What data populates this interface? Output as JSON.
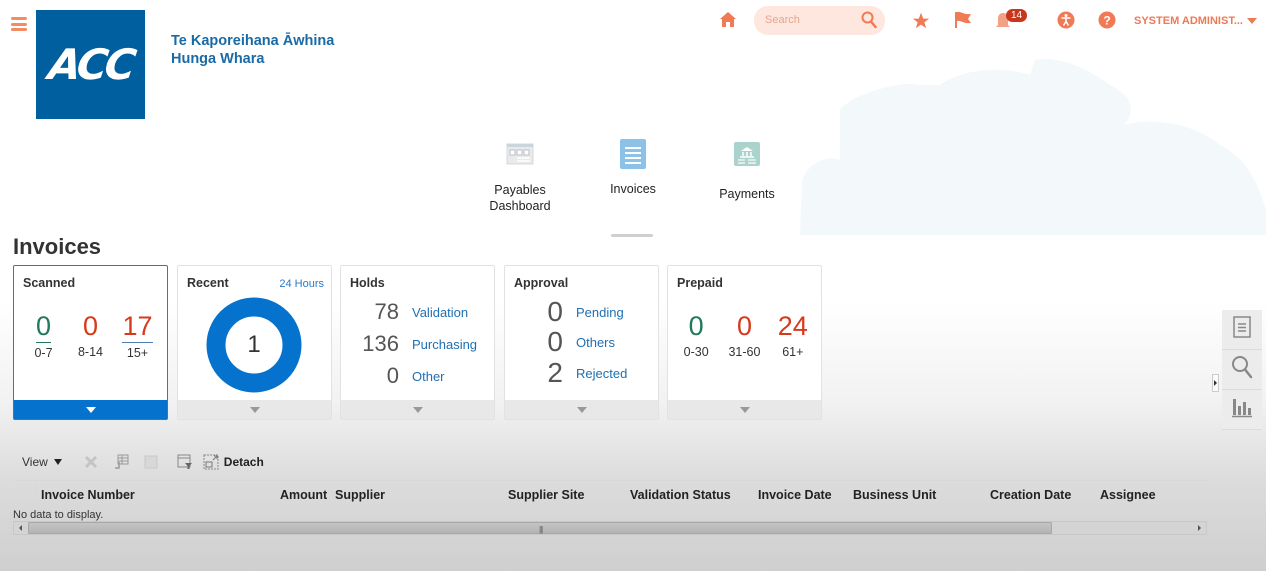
{
  "header": {
    "logo_text": "ACC",
    "brand_line1": "Te Kaporeihana Āwhina",
    "brand_line2": "Hunga Whara",
    "search_placeholder": "Search",
    "notifications_count": "14",
    "user_label": "SYSTEM ADMINIST...",
    "icons": [
      "menu-icon",
      "home-icon",
      "search-icon",
      "favorites-star-icon",
      "flag-icon",
      "notifications-bell-icon",
      "accessibility-icon",
      "help-icon"
    ]
  },
  "nav": {
    "items": [
      {
        "label_line1": "Payables",
        "label_line2": "Dashboard",
        "icon": "dashboard-icon"
      },
      {
        "label_line1": "Invoices",
        "label_line2": "",
        "icon": "invoices-icon",
        "selected": true
      },
      {
        "label_line1": "Payments",
        "label_line2": "",
        "icon": "payments-bank-icon"
      }
    ]
  },
  "page": {
    "title": "Invoices"
  },
  "cards": {
    "scanned": {
      "title": "Scanned",
      "buckets": [
        {
          "value": "0",
          "label": "0-7",
          "color": "#1f7a5a"
        },
        {
          "value": "0",
          "label": "8-14",
          "color": "#d8391b"
        },
        {
          "value": "17",
          "label": "15+",
          "color": "#d8391b"
        }
      ]
    },
    "recent": {
      "title": "Recent",
      "period_link": "24 Hours",
      "value": "1",
      "ring_color": "#0572ce"
    },
    "holds": {
      "title": "Holds",
      "rows": [
        {
          "value": "78",
          "label": "Validation"
        },
        {
          "value": "136",
          "label": "Purchasing"
        },
        {
          "value": "0",
          "label": "Other"
        }
      ]
    },
    "approval": {
      "title": "Approval",
      "rows": [
        {
          "value": "0",
          "label": "Pending"
        },
        {
          "value": "0",
          "label": "Others"
        },
        {
          "value": "2",
          "label": "Rejected"
        }
      ]
    },
    "prepaid": {
      "title": "Prepaid",
      "buckets": [
        {
          "value": "0",
          "label": "0-30",
          "color": "#1f7a5a"
        },
        {
          "value": "0",
          "label": "31-60",
          "color": "#d8391b"
        },
        {
          "value": "24",
          "label": "61+",
          "color": "#d8391b"
        }
      ]
    }
  },
  "table": {
    "toolbar": {
      "view_label": "View",
      "detach_label": "Detach"
    },
    "columns": [
      "Invoice Number",
      "Amount",
      "Supplier",
      "Supplier Site",
      "Validation Status",
      "Invoice Date",
      "Business Unit",
      "Creation Date",
      "Assignee"
    ],
    "empty_message": "No data to display."
  },
  "side_panel": {
    "buttons": [
      "tasks-icon",
      "search-icon",
      "reports-chart-icon"
    ]
  },
  "colors": {
    "accent_orange": "#f07a54",
    "brand_blue": "#00609f",
    "link_blue": "#1f6fb1",
    "good_green": "#1f7a5a",
    "alert_red": "#d8391b"
  }
}
